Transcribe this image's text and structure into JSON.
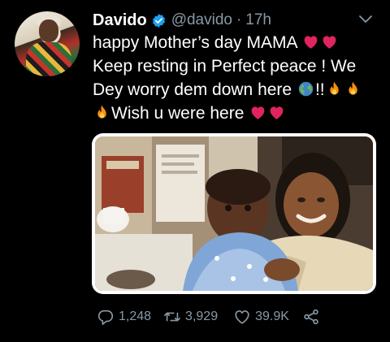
{
  "tweet": {
    "author": {
      "display_name": "Davido",
      "handle": "@davido",
      "verified": true,
      "verified_color": "#1da1f2"
    },
    "separator": "·",
    "time": "17h",
    "text_lines": [
      "happy Mother’s  day MAMA",
      "Keep resting in Perfect peace ! We",
      "Dey worry dem down here",
      "!!",
      "Wish u were here"
    ],
    "emoji": {
      "line1": [
        "red-heart",
        "red-heart"
      ],
      "line3_before": [
        "globe"
      ],
      "line3_after": [
        "fire",
        "fire"
      ],
      "line4_before": [
        "fire"
      ],
      "line4_after": [
        "red-heart",
        "red-heart"
      ]
    },
    "actions": {
      "reply_count": "1,248",
      "retweet_count": "3,929",
      "like_count": "39.9K",
      "reply_icon": "reply-icon",
      "retweet_icon": "retweet-icon",
      "like_icon": "heart-icon",
      "share_icon": "share-icon"
    },
    "colors": {
      "background": "#000000",
      "text": "#ffffff",
      "secondary": "#8899a6"
    }
  }
}
